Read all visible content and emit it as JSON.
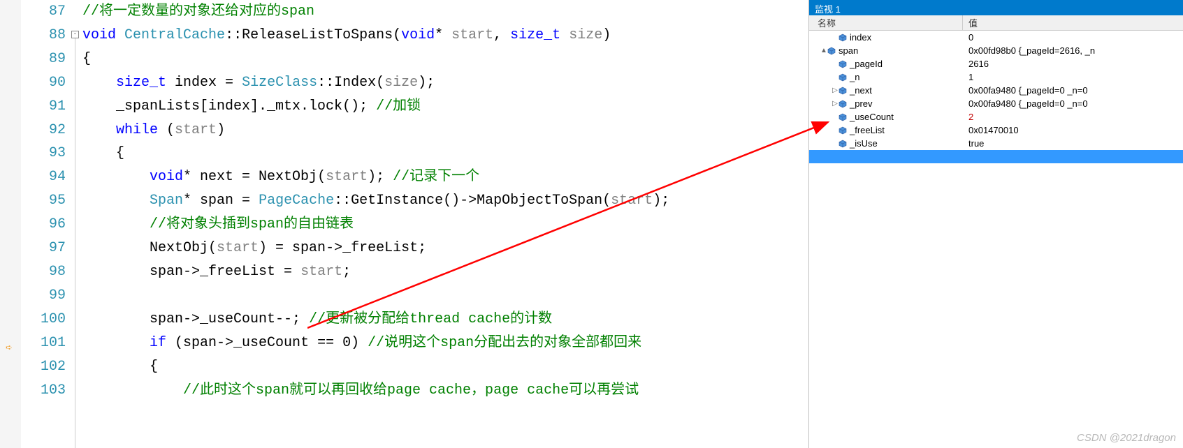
{
  "editor": {
    "lines": [
      {
        "num": "87",
        "tokens": [
          {
            "t": "//将一定数量的对象还给对应的span",
            "c": "cm",
            "pre": ""
          }
        ]
      },
      {
        "num": "88",
        "tokens": [
          {
            "t": "void",
            "c": "kw",
            "pre": ""
          },
          {
            "t": " ",
            "c": "op"
          },
          {
            "t": "CentralCache",
            "c": "ty"
          },
          {
            "t": "::ReleaseListToSpans(",
            "c": "fn"
          },
          {
            "t": "void",
            "c": "kw"
          },
          {
            "t": "* ",
            "c": "op"
          },
          {
            "t": "start",
            "c": "pa"
          },
          {
            "t": ", ",
            "c": "op"
          },
          {
            "t": "size_t",
            "c": "kw"
          },
          {
            "t": " ",
            "c": "op"
          },
          {
            "t": "size",
            "c": "pa"
          },
          {
            "t": ")",
            "c": "fn"
          }
        ]
      },
      {
        "num": "89",
        "tokens": [
          {
            "t": "{",
            "c": "op",
            "pre": ""
          }
        ]
      },
      {
        "num": "90",
        "tokens": [
          {
            "t": "    ",
            "c": "op"
          },
          {
            "t": "size_t",
            "c": "kw"
          },
          {
            "t": " index = ",
            "c": "id"
          },
          {
            "t": "SizeClass",
            "c": "ty"
          },
          {
            "t": "::Index(",
            "c": "fn"
          },
          {
            "t": "size",
            "c": "pa"
          },
          {
            "t": ");",
            "c": "op"
          }
        ]
      },
      {
        "num": "91",
        "tokens": [
          {
            "t": "    _spanLists[index]._mtx.lock(); ",
            "c": "id"
          },
          {
            "t": "//加锁",
            "c": "cm"
          }
        ]
      },
      {
        "num": "92",
        "tokens": [
          {
            "t": "    ",
            "c": "op"
          },
          {
            "t": "while",
            "c": "kw"
          },
          {
            "t": " (",
            "c": "op"
          },
          {
            "t": "start",
            "c": "pa"
          },
          {
            "t": ")",
            "c": "op"
          }
        ]
      },
      {
        "num": "93",
        "tokens": [
          {
            "t": "    {",
            "c": "op"
          }
        ]
      },
      {
        "num": "94",
        "tokens": [
          {
            "t": "        ",
            "c": "op"
          },
          {
            "t": "void",
            "c": "kw"
          },
          {
            "t": "* next = NextObj(",
            "c": "id"
          },
          {
            "t": "start",
            "c": "pa"
          },
          {
            "t": "); ",
            "c": "op"
          },
          {
            "t": "//记录下一个",
            "c": "cm"
          }
        ]
      },
      {
        "num": "95",
        "tokens": [
          {
            "t": "        ",
            "c": "op"
          },
          {
            "t": "Span",
            "c": "ty"
          },
          {
            "t": "* span = ",
            "c": "id"
          },
          {
            "t": "PageCache",
            "c": "ty"
          },
          {
            "t": "::GetInstance()->MapObjectToSpan(",
            "c": "fn"
          },
          {
            "t": "start",
            "c": "pa"
          },
          {
            "t": ");",
            "c": "op"
          }
        ]
      },
      {
        "num": "96",
        "tokens": [
          {
            "t": "        ",
            "c": "op"
          },
          {
            "t": "//将对象头插到span的自由链表",
            "c": "cm"
          }
        ]
      },
      {
        "num": "97",
        "tokens": [
          {
            "t": "        NextObj(",
            "c": "id"
          },
          {
            "t": "start",
            "c": "pa"
          },
          {
            "t": ") = span->_freeList;",
            "c": "id"
          }
        ]
      },
      {
        "num": "98",
        "tokens": [
          {
            "t": "        span->_freeList = ",
            "c": "id"
          },
          {
            "t": "start",
            "c": "pa"
          },
          {
            "t": ";",
            "c": "op"
          }
        ]
      },
      {
        "num": "99",
        "tokens": []
      },
      {
        "num": "100",
        "tokens": [
          {
            "t": "        span->_useCount--; ",
            "c": "id"
          },
          {
            "t": "//更新被分配给thread cache的计数",
            "c": "cm"
          }
        ]
      },
      {
        "num": "101",
        "tokens": [
          {
            "t": "        ",
            "c": "op"
          },
          {
            "t": "if",
            "c": "kw"
          },
          {
            "t": " (span->_useCount == 0) ",
            "c": "id"
          },
          {
            "t": "//说明这个span分配出去的对象全部都回来",
            "c": "cm"
          }
        ]
      },
      {
        "num": "102",
        "tokens": [
          {
            "t": "        {",
            "c": "op"
          }
        ]
      },
      {
        "num": "103",
        "tokens": [
          {
            "t": "            ",
            "c": "op"
          },
          {
            "t": "//此时这个span就可以再回收给page cache，page cache可以再尝试",
            "c": "cm"
          }
        ]
      }
    ]
  },
  "watch": {
    "title": "监视 1",
    "header_name": "名称",
    "header_value": "值",
    "rows": [
      {
        "indent": 1,
        "expander": "",
        "name": "index",
        "value": "0",
        "red": false
      },
      {
        "indent": 0,
        "expander": "▲",
        "name": "span",
        "value": "0x00fd98b0 {_pageId=2616, _n",
        "red": false
      },
      {
        "indent": 1,
        "expander": "",
        "name": "_pageId",
        "value": "2616",
        "red": false
      },
      {
        "indent": 1,
        "expander": "",
        "name": "_n",
        "value": "1",
        "red": false
      },
      {
        "indent": 1,
        "expander": "▷",
        "name": "_next",
        "value": "0x00fa9480 {_pageId=0 _n=0",
        "red": false
      },
      {
        "indent": 1,
        "expander": "▷",
        "name": "_prev",
        "value": "0x00fa9480 {_pageId=0 _n=0",
        "red": false
      },
      {
        "indent": 1,
        "expander": "",
        "name": "_useCount",
        "value": "2",
        "red": true
      },
      {
        "indent": 1,
        "expander": "",
        "name": "_freeList",
        "value": "0x01470010",
        "red": false
      },
      {
        "indent": 1,
        "expander": "",
        "name": "_isUse",
        "value": "true",
        "red": false
      }
    ],
    "blank_selected": true
  },
  "watermark": "CSDN @2021dragon"
}
